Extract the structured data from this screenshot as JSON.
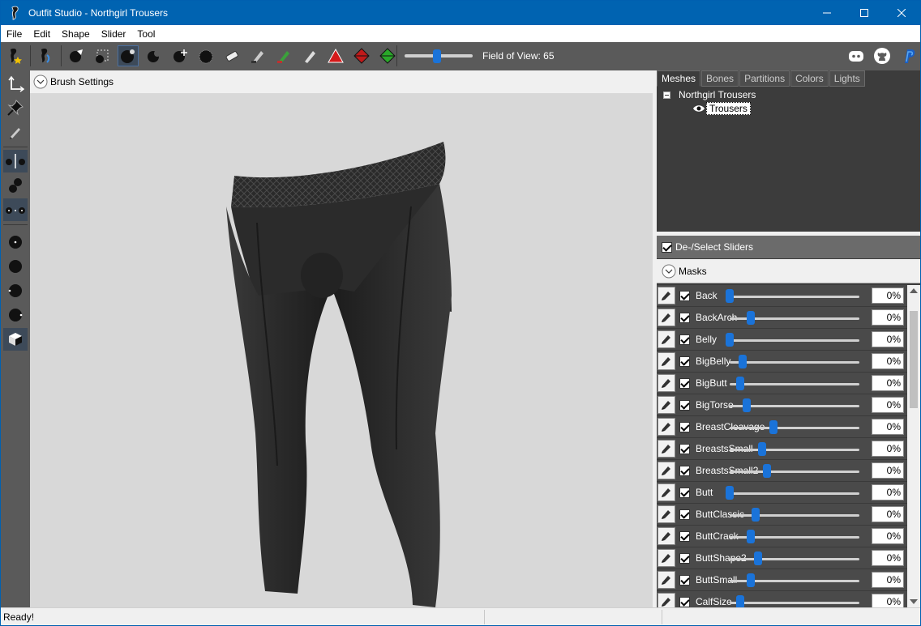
{
  "window": {
    "title": "Outfit Studio - Northgirl Trousers"
  },
  "menu": [
    "File",
    "Edit",
    "Shape",
    "Slider",
    "Tool"
  ],
  "toolbar": {
    "fov_label": "Field of View: 65",
    "fov_value": 65
  },
  "viewport": {
    "brush_settings_label": "Brush Settings"
  },
  "tabs": [
    "Meshes",
    "Bones",
    "Partitions",
    "Colors",
    "Lights"
  ],
  "active_tab": "Meshes",
  "tree": {
    "root": "Northgirl Trousers",
    "child": "Trousers"
  },
  "deselect_label": "De-/Select Sliders",
  "masks_label": "Masks",
  "sliders": [
    {
      "name": "Back",
      "value": "0%",
      "position": 0.0
    },
    {
      "name": "BackArch",
      "value": "0%",
      "position": 0.16
    },
    {
      "name": "Belly",
      "value": "0%",
      "position": 0.0
    },
    {
      "name": "BigBelly",
      "value": "0%",
      "position": 0.1
    },
    {
      "name": "BigButt",
      "value": "0%",
      "position": 0.08
    },
    {
      "name": "BigTorso",
      "value": "0%",
      "position": 0.13
    },
    {
      "name": "BreastCleavage",
      "value": "0%",
      "position": 0.34
    },
    {
      "name": "BreastsSmall",
      "value": "0%",
      "position": 0.25
    },
    {
      "name": "BreastsSmall2",
      "value": "0%",
      "position": 0.29
    },
    {
      "name": "Butt",
      "value": "0%",
      "position": 0.0
    },
    {
      "name": "ButtClassic",
      "value": "0%",
      "position": 0.2
    },
    {
      "name": "ButtCrack",
      "value": "0%",
      "position": 0.16
    },
    {
      "name": "ButtShape2",
      "value": "0%",
      "position": 0.22
    },
    {
      "name": "ButtSmall",
      "value": "0%",
      "position": 0.16
    },
    {
      "name": "CalfSize",
      "value": "0%",
      "position": 0.08
    }
  ],
  "status": {
    "text": "Ready!"
  }
}
